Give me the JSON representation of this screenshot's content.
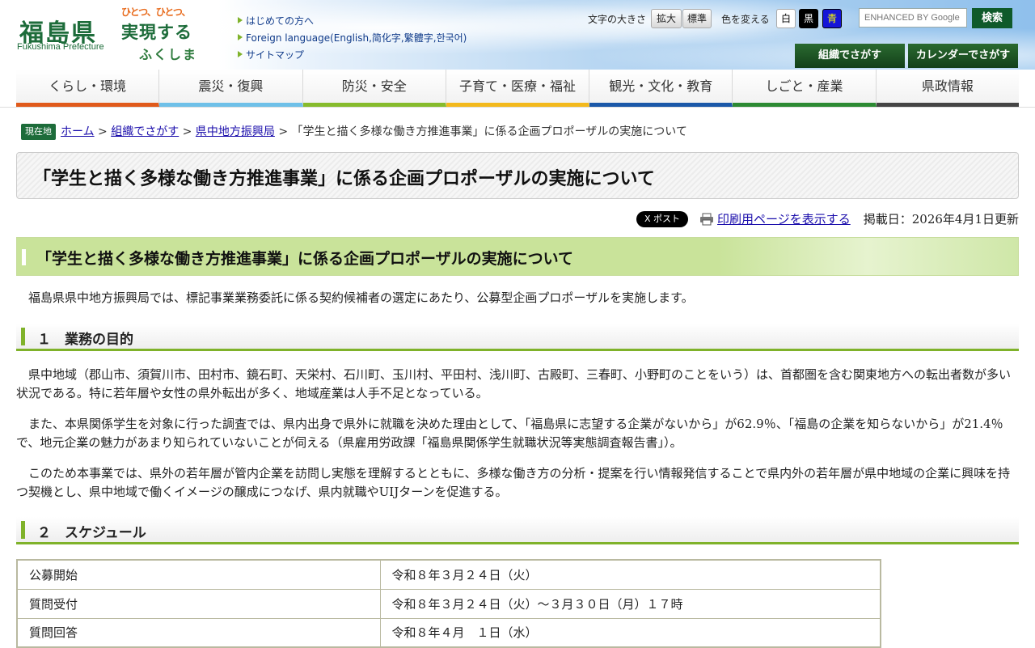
{
  "header": {
    "logo_main": "福島県",
    "logo_sub": "Fukushima Prefecture",
    "slogan_lines": [
      "ひとつ、ひとつ、",
      "実現する",
      "ふくしま"
    ],
    "links": [
      {
        "label": "はじめての方へ"
      },
      {
        "label": "Foreign language(English,简化字,繁體字,한국어)"
      },
      {
        "label": "サイトマップ"
      }
    ],
    "text_size_label": "文字の大きさ",
    "text_size_buttons": [
      "拡大",
      "標準"
    ],
    "color_label": "色を変える",
    "color_buttons": [
      "白",
      "黒",
      "青"
    ],
    "search": {
      "placeholder": "ENHANCED BY Google",
      "button": "検索"
    },
    "green_buttons": [
      "組織でさがす",
      "カレンダーでさがす"
    ]
  },
  "nav": {
    "items": [
      {
        "label": "くらし・環境",
        "color": "#e05a1b"
      },
      {
        "label": "震災・復興",
        "color": "#6fc0e8"
      },
      {
        "label": "防災・安全",
        "color": "#86bb2c"
      },
      {
        "label": "子育て・医療・福祉",
        "color": "#f3b91c"
      },
      {
        "label": "観光・文化・教育",
        "color": "#1b58a8"
      },
      {
        "label": "しごと・産業",
        "color": "#2c8a33"
      },
      {
        "label": "県政情報",
        "color": "#444444"
      }
    ]
  },
  "breadcrumb": {
    "here": "現在地",
    "links": [
      "ホーム",
      "組織でさがす",
      "県中地方振興局"
    ],
    "current": "「学生と描く多様な働き方推進事業」に係る企画プロポーザルの実施について"
  },
  "page_title": "「学生と描く多様な働き方推進事業」に係る企画プロポーザルの実施について",
  "meta": {
    "post_label": "X ポスト",
    "print_label": "印刷用ページを表示する",
    "updated": "掲載日：2026年4月1日更新"
  },
  "content": {
    "heading": "「学生と描く多様な働き方推進事業」に係る企画プロポーザルの実施について",
    "intro": "　福島県県中地方振興局では、標記事業業務委託に係る契約候補者の選定にあたり、公募型企画プロポーザルを実施します。",
    "sections": [
      {
        "title": "１　業務の目的",
        "paragraphs": [
          "　県中地域（郡山市、須賀川市、田村市、鏡石町、天栄村、石川町、玉川村、平田村、浅川町、古殿町、三春町、小野町のことをいう）は、首都圏を含む関東地方への転出者数が多い状況である。特に若年層や女性の県外転出が多く、地域産業は人手不足となっている。",
          "　また、本県関係学生を対象に行った調査では、県内出身で県外に就職を決めた理由として、「福島県に志望する企業がないから」が62.9％、「福島の企業を知らないから」が21.4％で、地元企業の魅力があまり知られていないことが伺える（県雇用労政課「福島県関係学生就職状況等実態調査報告書」）。",
          "　このため本事業では、県外の若年層が管内企業を訪問し実態を理解するとともに、多様な働き方の分析・提案を行い情報発信することで県内外の若年層が県中地域の企業に興味を持つ契機とし、県中地域で働くイメージの醸成につなげ、県内就職やUIJターンを促進する。"
        ]
      },
      {
        "title": "２　スケジュール",
        "schedule": [
          {
            "item": "公募開始",
            "date": "令和８年３月２４日（火）"
          },
          {
            "item": "質問受付",
            "date": "令和８年３月２４日（火）～３月３０日（月）１７時"
          },
          {
            "item": "質問回答",
            "date": "令和８年４月　１日（水）"
          }
        ]
      }
    ]
  }
}
